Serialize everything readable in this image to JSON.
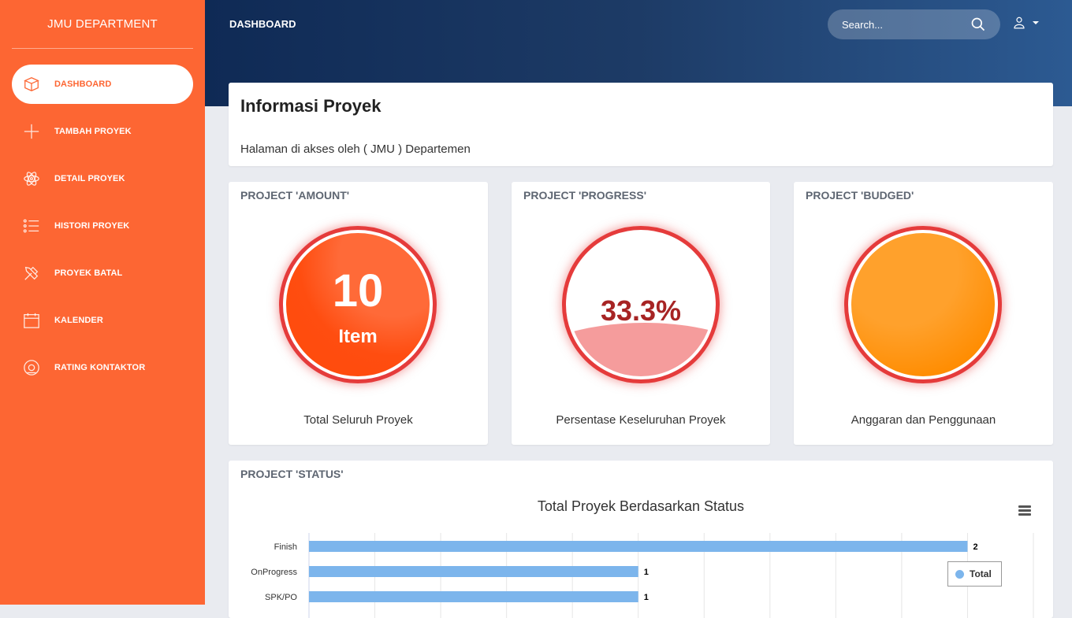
{
  "sidebar": {
    "brand": "JMU DEPARTMENT",
    "items": [
      {
        "label": "DASHBOARD",
        "icon": "box-icon",
        "active": true
      },
      {
        "label": "TAMBAH PROYEK",
        "icon": "plus-icon",
        "active": false
      },
      {
        "label": "DETAIL PROYEK",
        "icon": "atom-icon",
        "active": false
      },
      {
        "label": "HISTORI PROYEK",
        "icon": "list-icon",
        "active": false
      },
      {
        "label": "PROYEK BATAL",
        "icon": "tools-icon",
        "active": false
      },
      {
        "label": "KALENDER",
        "icon": "calendar-icon",
        "active": false
      },
      {
        "label": "RATING KONTAKTOR",
        "icon": "circle-at-icon",
        "active": false
      }
    ]
  },
  "topbar": {
    "breadcrumb": "DASHBOARD",
    "search_placeholder": "Search..."
  },
  "info": {
    "title": "Informasi Proyek",
    "subtitle": "Halaman di akses oleh ( JMU ) Departemen"
  },
  "stats": {
    "amount": {
      "heading": "PROJECT 'AMOUNT'",
      "value": "10",
      "unit": "Item",
      "caption": "Total Seluruh Proyek"
    },
    "progress": {
      "heading": "PROJECT 'PROGRESS'",
      "value": "33.3%",
      "fill_fraction": 0.333,
      "caption": "Persentase Keseluruhan Proyek"
    },
    "budget": {
      "heading": "PROJECT 'BUDGED'",
      "caption": "Anggaran dan Penggunaan"
    }
  },
  "status_card": {
    "heading": "PROJECT 'STATUS'"
  },
  "chart_data": {
    "type": "bar",
    "title": "Total Proyek Berdasarkan Status",
    "categories": [
      "Finish",
      "OnProgress",
      "SPK/PO"
    ],
    "series": [
      {
        "name": "Total",
        "values": [
          2,
          1,
          1
        ],
        "color": "#7cb5ec"
      }
    ],
    "xlim": [
      0,
      2.2
    ],
    "legend": "right"
  },
  "colors": {
    "sidebar": "#fd6633",
    "ring": "#e53b3b",
    "bar": "#7cb5ec"
  }
}
